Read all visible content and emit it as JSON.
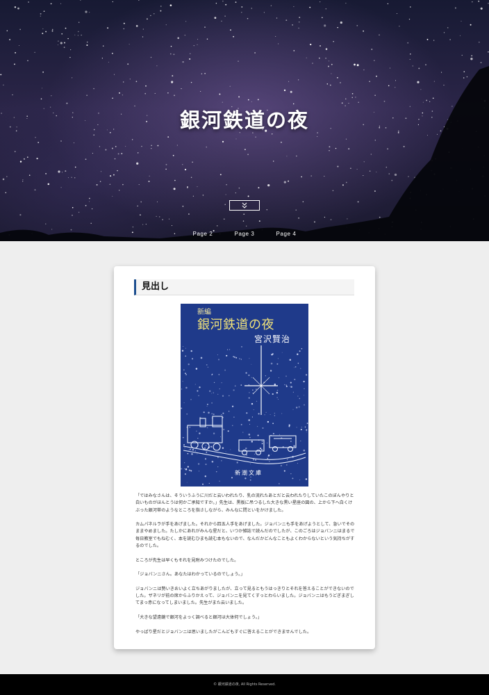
{
  "hero": {
    "title": "銀河鉄道の夜",
    "scroll_icon": "double-chevron-down-icon",
    "nav": [
      "Page 2",
      "Page 3",
      "Page 4"
    ]
  },
  "article": {
    "heading": "見出し",
    "heading_accent": "#1d4f8f",
    "book_cover": {
      "small_title": "新編",
      "title": "銀河鉄道の夜",
      "author": "宮沢賢治",
      "publisher": "新潮文庫",
      "cover_color": "#1f3a8a"
    },
    "paragraphs": [
      "「ではみなさんは、そういうふうに川だと云いわれたり、乳の流れたあとだと云われたりしていたこのぼんやりと白いものがほんとうは何かご承知ですか。」先生は、黒板に吊つるした大きな黒い星座の図の、上から下へ白くけぶった銀河帯のようなところを指さしながら、みんなに問といをかけました。",
      "カムパネルラが手をあげました。それから四五人手をあげました。ジョバンニも手をあげようとして、急いでそのままやめました。たしかにあれがみんな星だと、いつか雑誌で読んだのでしたが、このごろはジョバンニはまるで毎日教室でもねむく、本を読むひまも読む本もないので、なんだかどんなこともよくわからないという気持ちがするのでした。",
      "ところが先生は早くもそれを見附みつけたのでした。",
      "「ジョバンニさん。あなたはわかっているのでしょう。」",
      "ジョバンニは勢いきおいよく立ちあがりましたが、立って見るともうはっきりとそれを答えることができないのでした。ザネリが前の席からふりかえって、ジョバンニを見てくすっとわらいました。ジョバンニはもうどぎまぎしてまっ赤になってしまいました。先生がまた云いました。",
      "「大きな望遠鏡で銀河をよっく調べると銀河は大体何でしょう。」",
      "やっぱり星だとジョバンニは思いましたがこんどもすぐに答えることができませんでした。"
    ]
  },
  "footer": {
    "copyright": "© 銀河鉄道の夜, All Rights Reserved."
  }
}
